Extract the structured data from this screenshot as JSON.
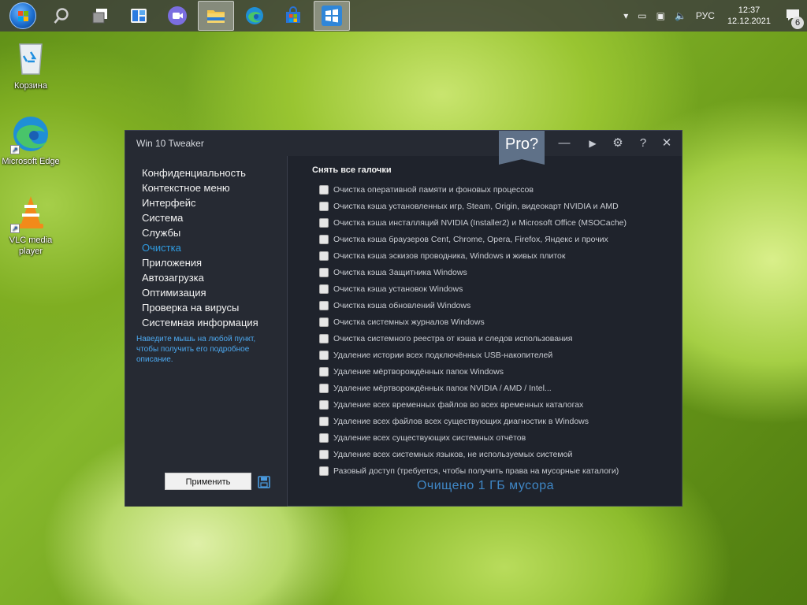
{
  "taskbar": {
    "language": "РУС",
    "time": "12:37",
    "date": "12.12.2021",
    "notification_count": "6",
    "apps": [
      {
        "icon": "search-icon"
      },
      {
        "icon": "task-view-icon"
      },
      {
        "icon": "widgets-icon"
      },
      {
        "icon": "meet-icon"
      },
      {
        "icon": "file-explorer-icon"
      },
      {
        "icon": "edge-icon"
      },
      {
        "icon": "store-icon"
      },
      {
        "icon": "win10-tweaker-icon"
      }
    ]
  },
  "desktop": {
    "icons": [
      {
        "label": "Корзина",
        "icon": "recycle-bin-icon"
      },
      {
        "label": "Microsoft Edge",
        "icon": "edge-icon"
      },
      {
        "label": "VLC media player",
        "icon": "vlc-icon"
      }
    ]
  },
  "window": {
    "title": "Win 10 Tweaker",
    "pro_label": "Pro?",
    "controls": {
      "minimize": "—",
      "run": "▶",
      "settings": "⚙",
      "help": "?",
      "close": "✕"
    },
    "nav": [
      {
        "label": "Конфиденциальность"
      },
      {
        "label": "Контекстное меню"
      },
      {
        "label": "Интерфейс"
      },
      {
        "label": "Система"
      },
      {
        "label": "Службы"
      },
      {
        "label": "Очистка",
        "active": true
      },
      {
        "label": "Приложения"
      },
      {
        "label": "Автозагрузка"
      },
      {
        "label": "Оптимизация"
      },
      {
        "label": "Проверка на вирусы"
      },
      {
        "label": "Системная информация"
      }
    ],
    "hint": "Наведите мышь на любой пункт, чтобы получить его подробное описание.",
    "apply_label": "Применить",
    "uncheck_all": "Снять все галочки",
    "options": [
      {
        "label": "Очистка оперативной памяти и фоновых процессов",
        "checked": false
      },
      {
        "label": "Очистка кэша установленных игр, Steam, Origin, видеокарт NVIDIA и AMD",
        "checked": false
      },
      {
        "label": "Очистка кэша инсталляций NVIDIA (Installer2) и Microsoft Office (MSOCache)",
        "checked": false
      },
      {
        "label": "Очистка кэша браузеров Cent, Chrome, Opera, Firefox, Яндекс и прочих",
        "checked": false
      },
      {
        "label": "Очистка кэша эскизов проводника, Windows и живых плиток",
        "checked": false
      },
      {
        "label": "Очистка кэша Защитника Windows",
        "checked": false
      },
      {
        "label": "Очистка кэша установок Windows",
        "checked": false
      },
      {
        "label": "Очистка кэша обновлений Windows",
        "checked": false
      },
      {
        "label": "Очистка системных журналов Windows",
        "checked": false
      },
      {
        "label": "Очистка системного реестра от кэша и следов использования",
        "checked": false
      },
      {
        "label": "Удаление истории всех подключённых USB-накопителей",
        "checked": false
      },
      {
        "label": "Удаление мёртворождённых папок Windows",
        "checked": false
      },
      {
        "label": "Удаление мёртворождённых папок NVIDIA / AMD / Intel...",
        "checked": false
      },
      {
        "label": "Удаление всех временных файлов во всех временных каталогах",
        "checked": false
      },
      {
        "label": "Удаление всех файлов всех существующих диагностик в Windows",
        "checked": false
      },
      {
        "label": "Удаление всех существующих системных отчётов",
        "checked": false
      },
      {
        "label": "Удаление всех системных языков, не используемых системой",
        "checked": false
      },
      {
        "label": "Разовый доступ (требуется, чтобы получить права на мусорные каталоги)",
        "checked": false
      }
    ],
    "status": "Очищено 1 ГБ мусора"
  }
}
